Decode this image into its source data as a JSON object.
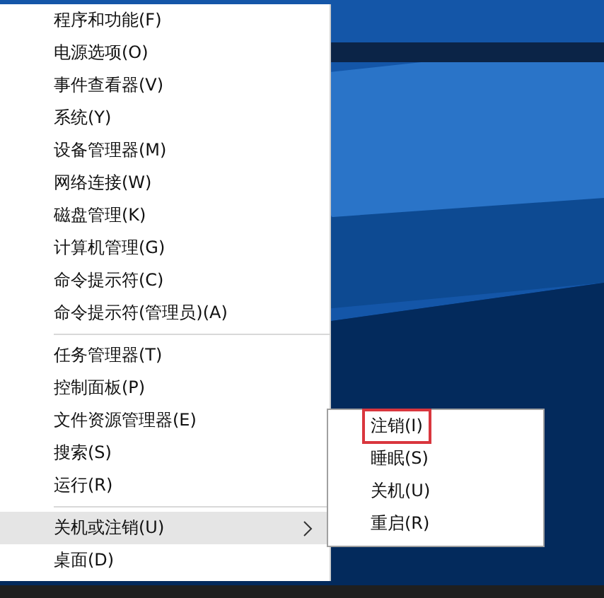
{
  "menu": {
    "groups": [
      {
        "items": [
          {
            "label": "程序和功能(F)",
            "selected": false,
            "submenu": false
          },
          {
            "label": "电源选项(O)",
            "selected": false,
            "submenu": false
          },
          {
            "label": "事件查看器(V)",
            "selected": false,
            "submenu": false
          },
          {
            "label": "系统(Y)",
            "selected": false,
            "submenu": false
          },
          {
            "label": "设备管理器(M)",
            "selected": false,
            "submenu": false
          },
          {
            "label": "网络连接(W)",
            "selected": false,
            "submenu": false
          },
          {
            "label": "磁盘管理(K)",
            "selected": false,
            "submenu": false
          },
          {
            "label": "计算机管理(G)",
            "selected": false,
            "submenu": false
          },
          {
            "label": "命令提示符(C)",
            "selected": false,
            "submenu": false
          },
          {
            "label": "命令提示符(管理员)(A)",
            "selected": false,
            "submenu": false
          }
        ]
      },
      {
        "items": [
          {
            "label": "任务管理器(T)",
            "selected": false,
            "submenu": false
          },
          {
            "label": "控制面板(P)",
            "selected": false,
            "submenu": false
          },
          {
            "label": "文件资源管理器(E)",
            "selected": false,
            "submenu": false
          },
          {
            "label": "搜索(S)",
            "selected": false,
            "submenu": false
          },
          {
            "label": "运行(R)",
            "selected": false,
            "submenu": false
          }
        ]
      },
      {
        "items": [
          {
            "label": "关机或注销(U)",
            "selected": true,
            "submenu": true
          },
          {
            "label": "桌面(D)",
            "selected": false,
            "submenu": false
          }
        ]
      }
    ]
  },
  "submenu": {
    "items": [
      {
        "label": "注销(I)",
        "annotated": true
      },
      {
        "label": "睡眠(S)",
        "annotated": false
      },
      {
        "label": "关机(U)",
        "annotated": false
      },
      {
        "label": "重启(R)",
        "annotated": false
      }
    ]
  }
}
